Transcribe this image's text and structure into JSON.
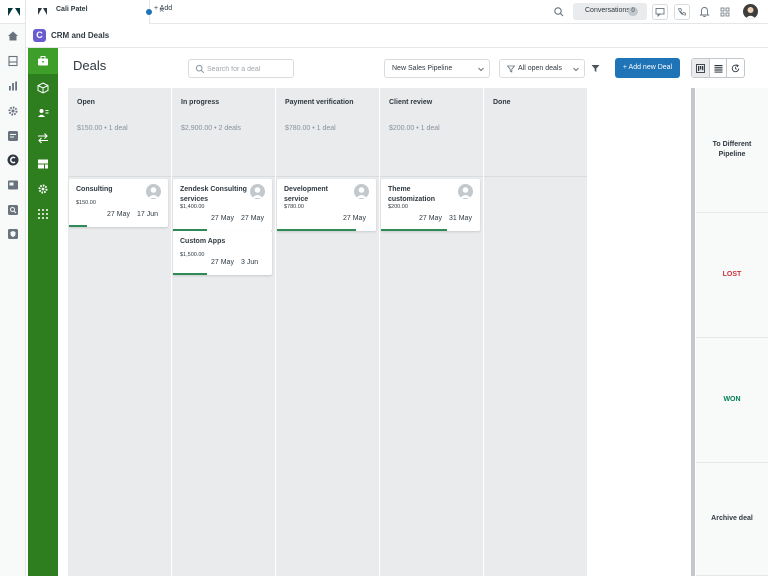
{
  "topbar": {
    "tab_label": "Cali Patel",
    "tab_close": "×",
    "add_label": "+ Add",
    "conversations_label": "Conversations",
    "conversations_count": "0"
  },
  "app": {
    "logo_letter": "C",
    "title": "CRM and Deals"
  },
  "toolbar": {
    "page_title": "Deals",
    "search_placeholder": "Search for a deal",
    "pipeline_select": "New Sales Pipeline",
    "filter_select": "All open deals",
    "add_button": "+ Add new Deal"
  },
  "columns": [
    {
      "title": "Open",
      "summary": "$150.00 • 1 deal",
      "cards": [
        {
          "title": "Consulting",
          "amount": "$150.00",
          "date1": "27 May",
          "date2": "17 Jun",
          "progress": 0.18,
          "avatar": true
        }
      ]
    },
    {
      "title": "In progress",
      "summary": "$2,900.00 • 2 deals",
      "cards": [
        {
          "title": "Zendesk Consulting services",
          "amount": "$1,400.00",
          "date1": "27 May",
          "date2": "27 May",
          "progress": 0.34,
          "avatar": true
        },
        {
          "title": "Custom Apps",
          "amount": "$1,500.00",
          "date1": "27 May",
          "date2": "3 Jun",
          "progress": 0.34,
          "avatar": false
        }
      ]
    },
    {
      "title": "Payment verification",
      "summary": "$780.00 • 1 deal",
      "cards": [
        {
          "title": "Development service",
          "amount": "$780.00",
          "date1": "",
          "date2": "27 May",
          "progress": 0.8,
          "avatar": true
        }
      ]
    },
    {
      "title": "Client review",
      "summary": "$200.00 • 1 deal",
      "cards": [
        {
          "title": "Theme customization",
          "amount": "$200.00",
          "date1": "27 May",
          "date2": "31 May",
          "progress": 0.67,
          "avatar": true
        }
      ]
    },
    {
      "title": "Done",
      "summary": "",
      "cards": []
    }
  ],
  "drop_zones": [
    {
      "label": "To Different Pipeline",
      "type": "pipeline"
    },
    {
      "label": "LOST",
      "type": "lost"
    },
    {
      "label": "WON",
      "type": "won"
    },
    {
      "label": "Archive deal",
      "type": "archive"
    }
  ],
  "colors": {
    "green_nav": "#2e7d1f",
    "primary_blue": "#1f73b7",
    "lost_red": "#cc3340",
    "won_green": "#038153",
    "progress_green": "#2e8b57"
  }
}
